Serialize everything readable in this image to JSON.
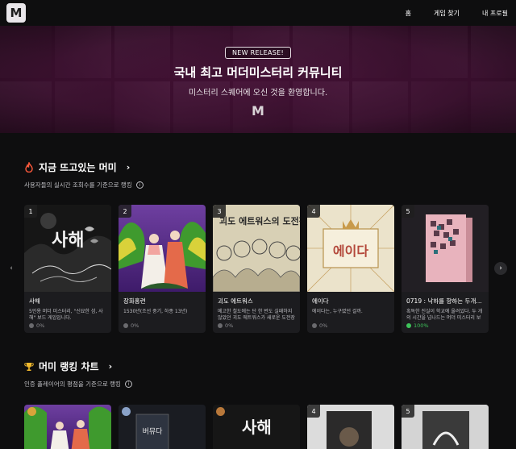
{
  "header": {
    "logo": "M",
    "nav": [
      "홈",
      "게임 찾기",
      "내 프로필"
    ]
  },
  "hero": {
    "badge": "NEW RELEASE!",
    "title": "국내 최고 머더미스터리 커뮤니티",
    "subtitle": "미스터리 스퀘어에 오신 것을 환영합니다.",
    "mark": "M"
  },
  "hot": {
    "title": "지금 뜨고있는 머미",
    "subtitle": "사용자들의 실시간 조회수를 기준으로 랭킹",
    "icon": "fire-icon",
    "cards": [
      {
        "rank": "1",
        "title": "사해",
        "desc": "5인용 머더 미스터리, \"신묘한 섬, 사해\" 보드 게임입니다.",
        "rate": "0%",
        "art_text": "사해"
      },
      {
        "rank": "2",
        "title": "장화홍련",
        "desc": "1530년(조선 중기, 하종 13년)",
        "rate": "0%"
      },
      {
        "rank": "3",
        "title": "괴도 에트워스",
        "desc": "메고한 철도에는 단 한 번도 실패하지 않았던 괴도 에트워스가 새로운 도전장을…",
        "rate": "0%",
        "art_text": "괴도 에트워스의 도전장"
      },
      {
        "rank": "4",
        "title": "에이다",
        "desc": "에이다는, 누구였던 걸까.",
        "rate": "0%",
        "art_text": "에이다"
      },
      {
        "rank": "5",
        "title": "0719 : 낙하를 향하는 두개의 수",
        "desc": "혹독한 진실이 학교에 울려있다. 두 개의 시간을 넘나드는 머더 미스터리 보드게임",
        "rate": "100%"
      }
    ]
  },
  "ranking": {
    "title": "머미 랭킹 차트",
    "subtitle": "인증 플레이어의 평점을 기준으로 랭킹",
    "icon": "trophy-icon",
    "cards": [
      {
        "rank": "1"
      },
      {
        "rank": "2"
      },
      {
        "rank": "3",
        "art_text": "사해"
      },
      {
        "rank": "4"
      },
      {
        "rank": "5"
      }
    ]
  },
  "colors": {
    "hero": "#4a103a",
    "accent_green": "#3ec35a",
    "background": "#0e0e0f"
  }
}
